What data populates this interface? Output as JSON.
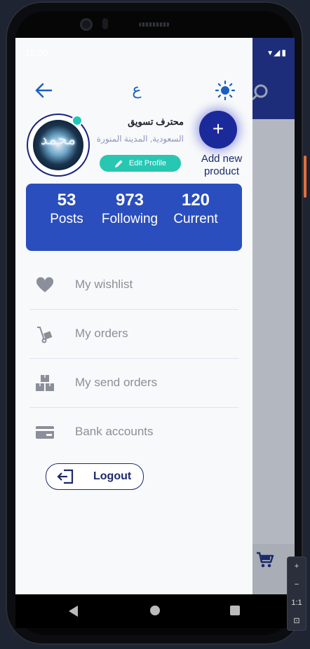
{
  "status": {
    "time": "12:00",
    "icons": "▾◢▮"
  },
  "topbar": {
    "back_label": "Back",
    "language_label": "ع",
    "theme_label": "Theme"
  },
  "profile": {
    "name": "محترف تسويق",
    "location": "السعودية, المدينة المنورة",
    "edit_label": "Edit Profile",
    "avatar_text": "محمد"
  },
  "add_product": {
    "icon": "+",
    "label_line1": "Add new",
    "label_line2": "product"
  },
  "stats": [
    {
      "value": "53",
      "label": "Posts"
    },
    {
      "value": "973",
      "label": "Following"
    },
    {
      "value": "120",
      "label": "Current"
    }
  ],
  "menu": [
    {
      "label": "My wishlist",
      "icon": "heart-icon"
    },
    {
      "label": "My orders",
      "icon": "hand-truck-icon"
    },
    {
      "label": "My send orders",
      "icon": "boxes-icon"
    },
    {
      "label": "Bank accounts",
      "icon": "credit-card-icon"
    }
  ],
  "logout": {
    "label": "Logout"
  },
  "zoom": {
    "plus": "+",
    "minus": "−",
    "ratio": "1:1",
    "fit": "⊡"
  },
  "colors": {
    "primary": "#2a4ebd",
    "accent": "#27c7b2",
    "dark": "#1b2a6b"
  }
}
